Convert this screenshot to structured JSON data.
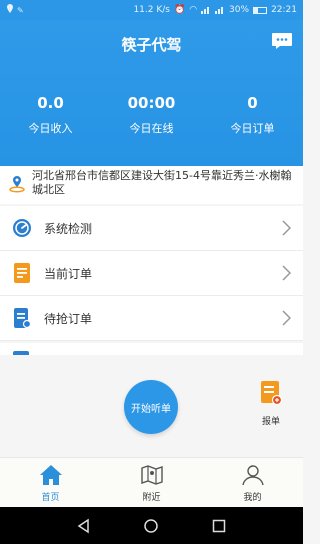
{
  "status_bar": {
    "speed": "11.2 K/s",
    "battery": "30%",
    "time": "22:21"
  },
  "header": {
    "title": "筷子代驾",
    "stats": [
      {
        "value": "0.0",
        "label": "今日收入"
      },
      {
        "value": "00:00",
        "label": "今日在线"
      },
      {
        "value": "0",
        "label": "今日订单"
      }
    ]
  },
  "address": {
    "text": "河北省邢台市信都区建设大街15-4号靠近秀兰·水榭翰城北区"
  },
  "menu": {
    "items": [
      {
        "label": "系统检测",
        "icon": "system-check-icon"
      },
      {
        "label": "当前订单",
        "icon": "current-order-icon"
      },
      {
        "label": "待抢订单",
        "icon": "pending-order-icon"
      }
    ]
  },
  "actions": {
    "start_label": "开始听单",
    "report_label": "报单"
  },
  "tabs": [
    {
      "label": "首页",
      "icon": "home-icon",
      "active": true
    },
    {
      "label": "附近",
      "icon": "map-icon",
      "active": false
    },
    {
      "label": "我的",
      "icon": "user-icon",
      "active": false
    }
  ],
  "colors": {
    "primary": "#2c97e6",
    "orange": "#f39a1e"
  }
}
